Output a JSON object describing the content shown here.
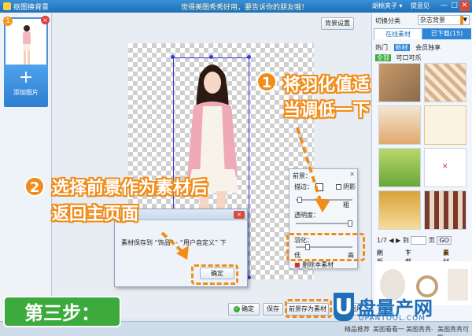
{
  "window": {
    "title": "抠图换背景",
    "slogan": "觉得美图秀秀好用，要告诉你的朋友哦！",
    "user": "胡桃夹子 ▾",
    "feedback": "提意见",
    "controls": [
      "—",
      "□",
      "✕"
    ]
  },
  "leftbar": {
    "thumb_badge": "1",
    "thumb_delete": "×",
    "add_label": "添加图片",
    "add_plus": "+"
  },
  "canvas": {
    "bg_settings": "背景设置"
  },
  "bottombar": {
    "confirm": "确定",
    "save": "保存",
    "save_foreground": "前景存为素材",
    "cancel": "图片"
  },
  "statusbar": {
    "items": [
      "精品推荐",
      "美图看看一",
      "美图秀秀-",
      "美图秀秀可靠"
    ]
  },
  "rightpanel": {
    "category_label": "切换分类",
    "category_value": "杂志背景",
    "tab_online": "在线素材",
    "tab_downloaded": "已下载(15)",
    "sub_hot": "热门",
    "sub_new": "新材",
    "sub_member": "会员独享",
    "filter_all": "全部",
    "filter_free": "可口可乐",
    "page_current": "1/7",
    "page_to": "到",
    "page_suffix": "页",
    "page_go": "GO",
    "refresh": "刷新",
    "download_page": "下载本页",
    "material_pack": "素材包"
  },
  "feather_panel": {
    "header": "前景：",
    "close": "✕",
    "stroke_label": "描边：",
    "shadow_label": "阴影",
    "stroke_right": "粗",
    "opacity_label": "透明度：",
    "feather_label": "羽化：",
    "feather_low": "低",
    "feather_high": "高",
    "feather_level": 0.18,
    "delete_material": "删除本素材"
  },
  "dialog": {
    "close": "✕",
    "message": "素材保存到 “饰品” - “用户自定义” 下",
    "ok": "确定"
  },
  "annotations": {
    "step1_num": "1",
    "step1_line1": "将羽化值适",
    "step1_line2": "当调低一下",
    "step2_num": "2",
    "step2_line1": "选择前景作为素材后",
    "step2_line2": "返回主页面",
    "step_badge": "第三步：",
    "accent_color": "#f08c1a",
    "badge_color": "#3caa3c"
  },
  "watermark": {
    "u": "U",
    "name": "盘量产网",
    "url": "UPANTOOL.COM"
  }
}
